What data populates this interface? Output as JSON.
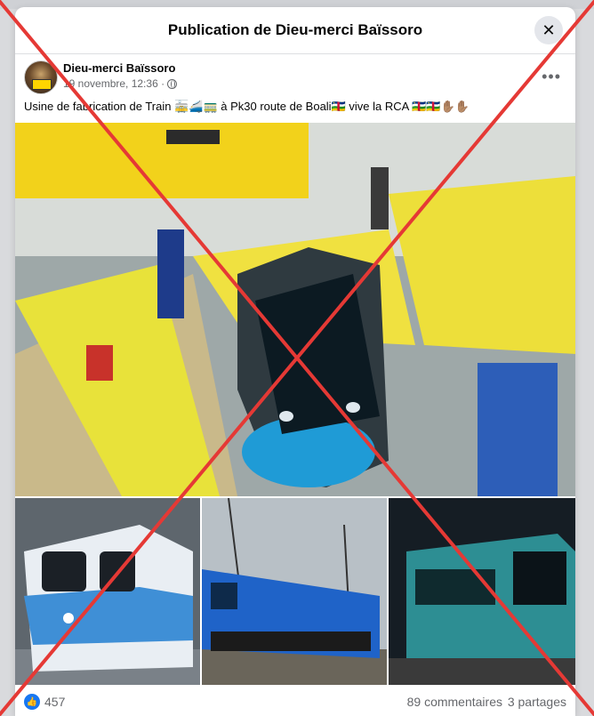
{
  "dialog": {
    "title": "Publication de Dieu-merci Baïssoro",
    "close_icon": "close-icon"
  },
  "post": {
    "author": "Dieu-merci Baïssoro",
    "timestamp": "19 novembre, 12:36 ·",
    "privacy_icon": "globe-icon",
    "more_label": "•••",
    "caption": "Usine de fabrication de Train 🚋🚄🚃 à Pk30 route de Boali🇨🇫 vive la RCA 🇨🇫🇨🇫✋🏽✋🏽"
  },
  "reactions": {
    "like_icon": "👍",
    "count": "457",
    "comments": "89 commentaires",
    "shares": "3 partages"
  },
  "overlay": {
    "cross_color": "#e53935"
  }
}
